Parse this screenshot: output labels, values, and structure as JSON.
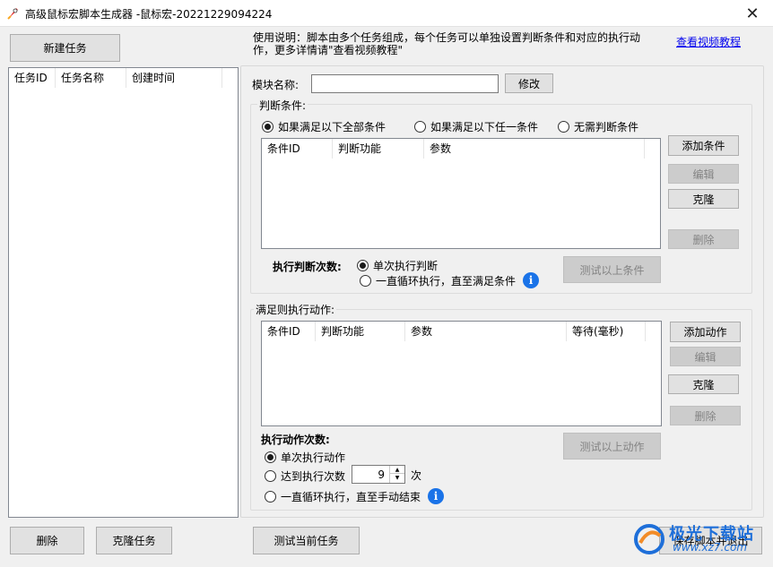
{
  "window": {
    "title": "高级鼠标宏脚本生成器 -鼠标宏-20221229094224",
    "close_glyph": "✕"
  },
  "left": {
    "new_task_button": "新建任务",
    "columns": [
      "任务ID",
      "任务名称",
      "创建时间"
    ],
    "delete_button": "删除",
    "clone_task_button": "克隆任务"
  },
  "usage": {
    "text": "使用说明：脚本由多个任务组成，每个任务可以单独设置判断条件和对应的执行动作，更多详情请\"查看视频教程\"",
    "video_link": "查看视频教程"
  },
  "module": {
    "label": "模块名称:",
    "value": "",
    "modify_button": "修改"
  },
  "conditions": {
    "group_label": "判断条件:",
    "radio_all": "如果满足以下全部条件",
    "radio_any": "如果满足以下任一条件",
    "radio_none": "无需判断条件",
    "columns": [
      "条件ID",
      "判断功能",
      "参数"
    ],
    "add_button": "添加条件",
    "edit_button": "编辑",
    "clone_button": "克隆",
    "delete_button": "删除",
    "exec_count_label": "执行判断次数:",
    "radio_single": "单次执行判断",
    "radio_loop": "一直循环执行，直至满足条件",
    "test_button": "测试以上条件"
  },
  "actions": {
    "group_label": "满足则执行动作:",
    "columns": [
      "条件ID",
      "判断功能",
      "参数",
      "等待(毫秒)"
    ],
    "add_button": "添加动作",
    "edit_button": "编辑",
    "clone_button": "克隆",
    "delete_button": "删除",
    "exec_count_label": "执行动作次数:",
    "radio_single": "单次执行动作",
    "radio_count": "达到执行次数",
    "count_value": "9",
    "count_unit": "次",
    "radio_loop": "一直循环执行，直至手动结束",
    "test_button": "测试以上动作"
  },
  "footer": {
    "test_current_button": "测试当前任务",
    "save_exit_button": "保存脚本并退出"
  },
  "info_glyph": "i",
  "watermark": {
    "line1": "极光下载站",
    "line2": "www.xz7.com"
  },
  "colors": {
    "accent": "#1a73e8",
    "link": "#0000ee"
  }
}
